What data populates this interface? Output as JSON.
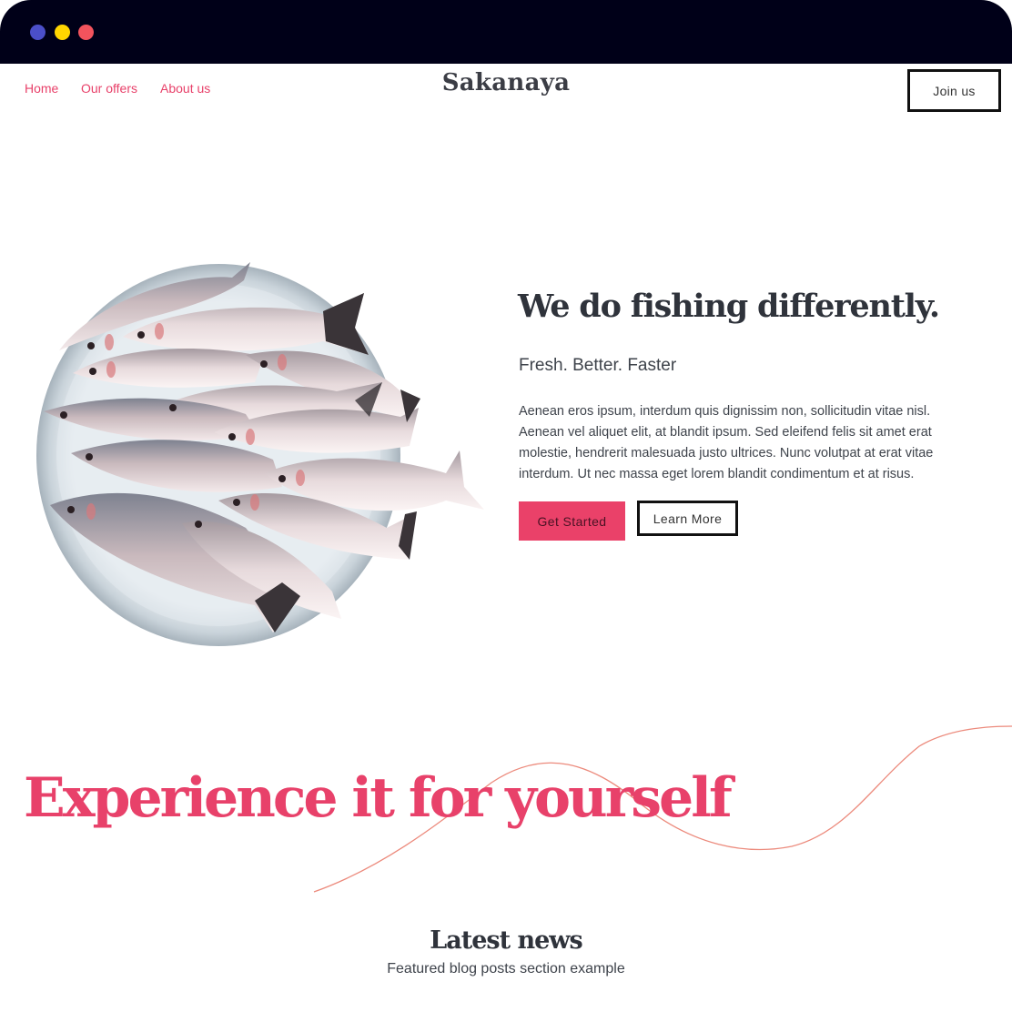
{
  "window": {
    "controls": [
      "close",
      "minimize",
      "maximize"
    ]
  },
  "nav": {
    "links": [
      "Home",
      "Our offers",
      "About us"
    ],
    "brand": "Sakanaya",
    "join_label": "Join us"
  },
  "hero": {
    "image_icon": "fish-platter-image",
    "headline": "We do fishing differently.",
    "subhead": "Fresh. Better. Faster",
    "body": "Aenean eros ipsum, interdum quis dignissim non, sollicitudin vitae nisl. Aenean vel aliquet elit, at blandit ipsum. Sed eleifend felis sit amet erat molestie, hendrerit malesuada justo ultrices. Nunc volutpat at erat vitae interdum. Ut nec massa eget lorem blandit condimentum et at risus.",
    "primary_label": "Get Started",
    "secondary_label": "Learn More"
  },
  "experience": {
    "title": "Experience it for yourself"
  },
  "news": {
    "title": "Latest news",
    "subtitle": "Featured blog posts section example"
  },
  "colors": {
    "accent": "#e8416a",
    "titlebar": "#000018",
    "wave": "#ec8a7c",
    "dot_blue": "#4b4fc9",
    "dot_yellow": "#ffd500",
    "dot_red": "#f2535d"
  }
}
